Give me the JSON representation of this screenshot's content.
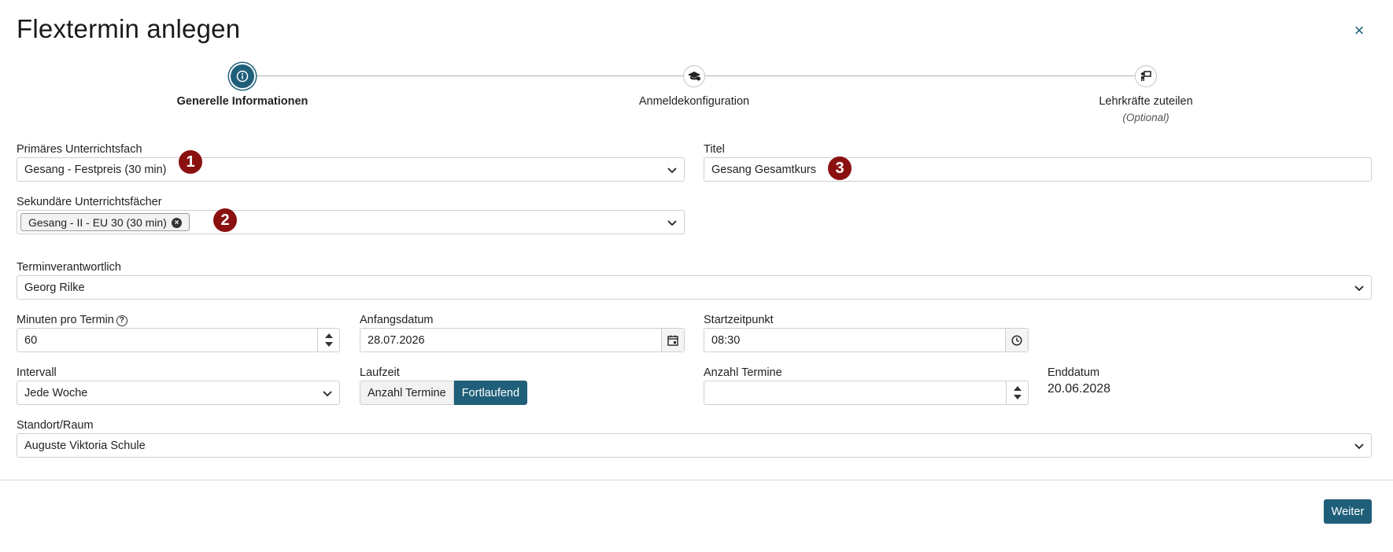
{
  "dialog": {
    "title": "Flextermin anlegen",
    "close_icon": "×"
  },
  "steps": [
    {
      "label": "Generelle Informationen",
      "sub": "",
      "active": true
    },
    {
      "label": "Anmeldekonfiguration",
      "sub": "",
      "active": false
    },
    {
      "label": "Lehrkräfte zuteilen",
      "sub": "(Optional)",
      "active": false
    }
  ],
  "form": {
    "primary_subject": {
      "label": "Primäres Unterrichtsfach",
      "value": "Gesang - Festpreis (30 min)"
    },
    "title": {
      "label": "Titel",
      "value": "Gesang Gesamtkurs"
    },
    "secondary_subjects": {
      "label": "Sekundäre Unterrichtsfächer",
      "chips": [
        "Gesang - II - EU 30 (30 min)"
      ]
    },
    "responsible": {
      "label": "Terminverantwortlich",
      "value": "Georg Rilke"
    },
    "minutes": {
      "label": "Minuten pro Termin",
      "value": "60"
    },
    "start_date": {
      "label": "Anfangsdatum",
      "value": "28.07.2026"
    },
    "start_time": {
      "label": "Startzeitpunkt",
      "value": "08:30"
    },
    "interval": {
      "label": "Intervall",
      "value": "Jede Woche"
    },
    "duration": {
      "label": "Laufzeit",
      "options": [
        "Anzahl Termine",
        "Fortlaufend"
      ],
      "selected": "Fortlaufend"
    },
    "count": {
      "label": "Anzahl Termine",
      "value": ""
    },
    "end_date": {
      "label": "Enddatum",
      "value": "20.06.2028"
    },
    "location": {
      "label": "Standort/Raum",
      "value": "Auguste Viktoria Schule"
    }
  },
  "annotations": [
    "1",
    "2",
    "3"
  ],
  "footer": {
    "next_label": "Weiter"
  },
  "colors": {
    "primary": "#1f5f7a",
    "annotation": "#8b1111"
  }
}
